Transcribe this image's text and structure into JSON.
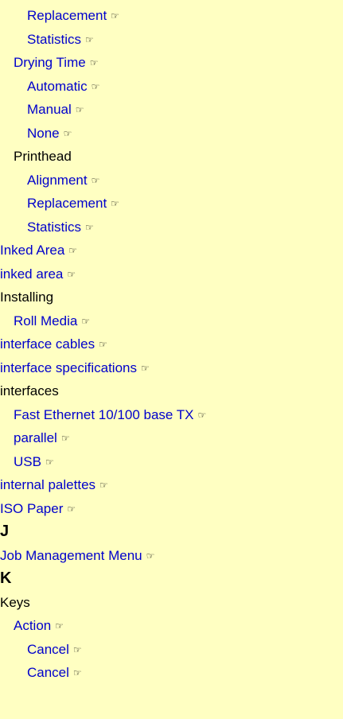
{
  "ref_glyph": "☞",
  "entries": [
    {
      "text": "Replacement",
      "level": 2,
      "link": true
    },
    {
      "text": "Statistics",
      "level": 2,
      "link": true
    },
    {
      "text": "Drying Time",
      "level": 1,
      "link": true
    },
    {
      "text": "Automatic",
      "level": 2,
      "link": true
    },
    {
      "text": "Manual",
      "level": 2,
      "link": true
    },
    {
      "text": "None",
      "level": 2,
      "link": true
    },
    {
      "text": "Printhead",
      "level": 1,
      "link": false
    },
    {
      "text": "Alignment",
      "level": 2,
      "link": true
    },
    {
      "text": "Replacement",
      "level": 2,
      "link": true
    },
    {
      "text": "Statistics",
      "level": 2,
      "link": true
    },
    {
      "text": "Inked Area",
      "level": 0,
      "link": true
    },
    {
      "text": "inked area",
      "level": 0,
      "link": true
    },
    {
      "text": "Installing",
      "level": 0,
      "link": false
    },
    {
      "text": "Roll Media",
      "level": 1,
      "link": true
    },
    {
      "text": "interface cables",
      "level": 0,
      "link": true
    },
    {
      "text": "interface specifications",
      "level": 0,
      "link": true
    },
    {
      "text": "interfaces",
      "level": 0,
      "link": false
    },
    {
      "text": "Fast Ethernet 10/100 base TX",
      "level": 1,
      "link": true
    },
    {
      "text": "parallel",
      "level": 1,
      "link": true
    },
    {
      "text": "USB",
      "level": 1,
      "link": true
    },
    {
      "text": "internal palettes",
      "level": 0,
      "link": true
    },
    {
      "text": "ISO Paper",
      "level": 0,
      "link": true
    },
    {
      "text": "J",
      "level": 0,
      "letter": true
    },
    {
      "text": "Job Management Menu",
      "level": 0,
      "link": true
    },
    {
      "text": "K",
      "level": 0,
      "letter": true
    },
    {
      "text": "Keys",
      "level": 0,
      "link": false
    },
    {
      "text": "Action",
      "level": 1,
      "link": true
    },
    {
      "text": "Cancel",
      "level": 2,
      "link": true
    },
    {
      "text": "Cancel",
      "level": 2,
      "link": true
    }
  ]
}
